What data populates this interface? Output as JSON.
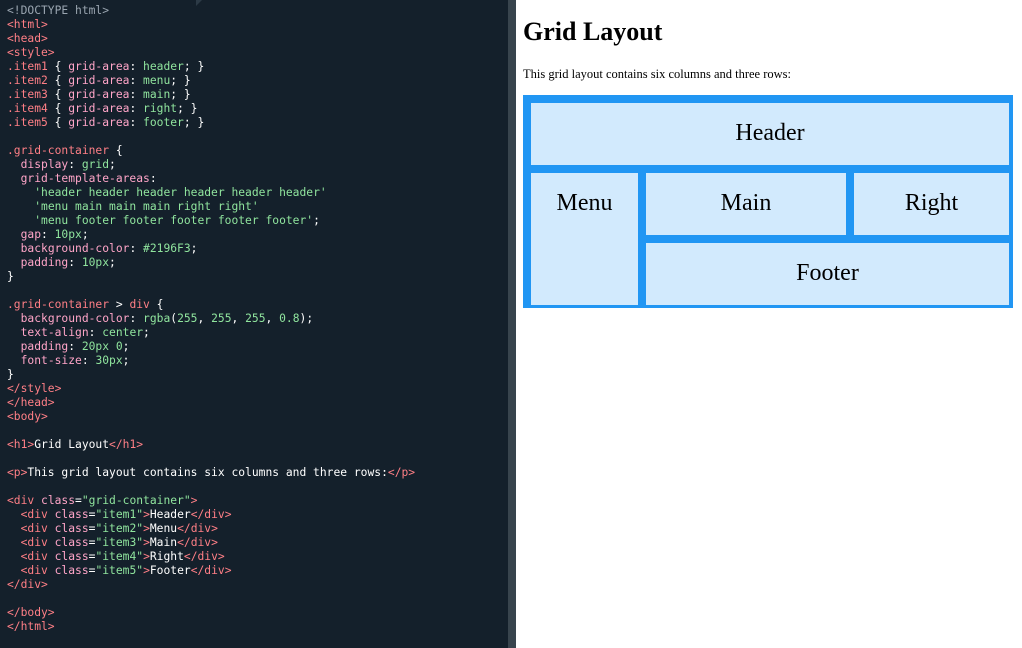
{
  "code_lines": [
    [
      [
        "tk-doctype",
        "<!DOCTYPE html>"
      ]
    ],
    [
      [
        "tk-tag",
        "<html>"
      ]
    ],
    [
      [
        "tk-tag",
        "<head>"
      ]
    ],
    [
      [
        "tk-tag",
        "<style>"
      ]
    ],
    [
      [
        "tk-sel",
        ".item1"
      ],
      [
        "tk-punct",
        " { "
      ],
      [
        "tk-prop",
        "grid-area"
      ],
      [
        "tk-punct",
        ": "
      ],
      [
        "tk-val",
        "header"
      ],
      [
        "tk-punct",
        "; }"
      ]
    ],
    [
      [
        "tk-sel",
        ".item2"
      ],
      [
        "tk-punct",
        " { "
      ],
      [
        "tk-prop",
        "grid-area"
      ],
      [
        "tk-punct",
        ": "
      ],
      [
        "tk-val",
        "menu"
      ],
      [
        "tk-punct",
        "; }"
      ]
    ],
    [
      [
        "tk-sel",
        ".item3"
      ],
      [
        "tk-punct",
        " { "
      ],
      [
        "tk-prop",
        "grid-area"
      ],
      [
        "tk-punct",
        ": "
      ],
      [
        "tk-val",
        "main"
      ],
      [
        "tk-punct",
        "; }"
      ]
    ],
    [
      [
        "tk-sel",
        ".item4"
      ],
      [
        "tk-punct",
        " { "
      ],
      [
        "tk-prop",
        "grid-area"
      ],
      [
        "tk-punct",
        ": "
      ],
      [
        "tk-val",
        "right"
      ],
      [
        "tk-punct",
        "; }"
      ]
    ],
    [
      [
        "tk-sel",
        ".item5"
      ],
      [
        "tk-punct",
        " { "
      ],
      [
        "tk-prop",
        "grid-area"
      ],
      [
        "tk-punct",
        ": "
      ],
      [
        "tk-val",
        "footer"
      ],
      [
        "tk-punct",
        "; }"
      ]
    ],
    [],
    [
      [
        "tk-sel",
        ".grid-container"
      ],
      [
        "tk-punct",
        " {"
      ]
    ],
    [
      [
        "tk-punct",
        "  "
      ],
      [
        "tk-prop",
        "display"
      ],
      [
        "tk-punct",
        ": "
      ],
      [
        "tk-val",
        "grid"
      ],
      [
        "tk-punct",
        ";"
      ]
    ],
    [
      [
        "tk-punct",
        "  "
      ],
      [
        "tk-prop",
        "grid-template-areas"
      ],
      [
        "tk-punct",
        ":"
      ]
    ],
    [
      [
        "tk-punct",
        "    "
      ],
      [
        "tk-val",
        "'header header header header header header'"
      ]
    ],
    [
      [
        "tk-punct",
        "    "
      ],
      [
        "tk-val",
        "'menu main main main right right'"
      ]
    ],
    [
      [
        "tk-punct",
        "    "
      ],
      [
        "tk-val",
        "'menu footer footer footer footer footer'"
      ],
      [
        "tk-punct",
        ";"
      ]
    ],
    [
      [
        "tk-punct",
        "  "
      ],
      [
        "tk-prop",
        "gap"
      ],
      [
        "tk-punct",
        ": "
      ],
      [
        "tk-val",
        "10px"
      ],
      [
        "tk-punct",
        ";"
      ]
    ],
    [
      [
        "tk-punct",
        "  "
      ],
      [
        "tk-prop",
        "background-color"
      ],
      [
        "tk-punct",
        ": "
      ],
      [
        "tk-val",
        "#2196F3"
      ],
      [
        "tk-punct",
        ";"
      ]
    ],
    [
      [
        "tk-punct",
        "  "
      ],
      [
        "tk-prop",
        "padding"
      ],
      [
        "tk-punct",
        ": "
      ],
      [
        "tk-val",
        "10px"
      ],
      [
        "tk-punct",
        ";"
      ]
    ],
    [
      [
        "tk-punct",
        "}"
      ]
    ],
    [],
    [
      [
        "tk-sel",
        ".grid-container"
      ],
      [
        "tk-punct",
        " > "
      ],
      [
        "tk-sel",
        "div"
      ],
      [
        "tk-punct",
        " {"
      ]
    ],
    [
      [
        "tk-punct",
        "  "
      ],
      [
        "tk-prop",
        "background-color"
      ],
      [
        "tk-punct",
        ": "
      ],
      [
        "tk-val",
        "rgba"
      ],
      [
        "tk-punct",
        "("
      ],
      [
        "tk-val",
        "255"
      ],
      [
        "tk-punct",
        ", "
      ],
      [
        "tk-val",
        "255"
      ],
      [
        "tk-punct",
        ", "
      ],
      [
        "tk-val",
        "255"
      ],
      [
        "tk-punct",
        ", "
      ],
      [
        "tk-val",
        "0.8"
      ],
      [
        "tk-punct",
        ");"
      ]
    ],
    [
      [
        "tk-punct",
        "  "
      ],
      [
        "tk-prop",
        "text-align"
      ],
      [
        "tk-punct",
        ": "
      ],
      [
        "tk-val",
        "center"
      ],
      [
        "tk-punct",
        ";"
      ]
    ],
    [
      [
        "tk-punct",
        "  "
      ],
      [
        "tk-prop",
        "padding"
      ],
      [
        "tk-punct",
        ": "
      ],
      [
        "tk-val",
        "20px 0"
      ],
      [
        "tk-punct",
        ";"
      ]
    ],
    [
      [
        "tk-punct",
        "  "
      ],
      [
        "tk-prop",
        "font-size"
      ],
      [
        "tk-punct",
        ": "
      ],
      [
        "tk-val",
        "30px"
      ],
      [
        "tk-punct",
        ";"
      ]
    ],
    [
      [
        "tk-punct",
        "}"
      ]
    ],
    [
      [
        "tk-tag",
        "</style>"
      ]
    ],
    [
      [
        "tk-tag",
        "</head>"
      ]
    ],
    [
      [
        "tk-tag",
        "<body>"
      ]
    ],
    [],
    [
      [
        "tk-tag",
        "<h1>"
      ],
      [
        "tk-text",
        "Grid Layout"
      ],
      [
        "tk-tag",
        "</h1>"
      ]
    ],
    [],
    [
      [
        "tk-tag",
        "<p>"
      ],
      [
        "tk-text",
        "This grid layout contains six columns and three rows:"
      ],
      [
        "tk-tag",
        "</p>"
      ]
    ],
    [],
    [
      [
        "tk-tag",
        "<div "
      ],
      [
        "tk-prop",
        "class"
      ],
      [
        "tk-punct",
        "="
      ],
      [
        "tk-val",
        "\"grid-container\""
      ],
      [
        "tk-tag",
        ">"
      ]
    ],
    [
      [
        "tk-punct",
        "  "
      ],
      [
        "tk-tag",
        "<div "
      ],
      [
        "tk-prop",
        "class"
      ],
      [
        "tk-punct",
        "="
      ],
      [
        "tk-val",
        "\"item1\""
      ],
      [
        "tk-tag",
        ">"
      ],
      [
        "tk-text",
        "Header"
      ],
      [
        "tk-tag",
        "</div>"
      ]
    ],
    [
      [
        "tk-punct",
        "  "
      ],
      [
        "tk-tag",
        "<div "
      ],
      [
        "tk-prop",
        "class"
      ],
      [
        "tk-punct",
        "="
      ],
      [
        "tk-val",
        "\"item2\""
      ],
      [
        "tk-tag",
        ">"
      ],
      [
        "tk-text",
        "Menu"
      ],
      [
        "tk-tag",
        "</div>"
      ]
    ],
    [
      [
        "tk-punct",
        "  "
      ],
      [
        "tk-tag",
        "<div "
      ],
      [
        "tk-prop",
        "class"
      ],
      [
        "tk-punct",
        "="
      ],
      [
        "tk-val",
        "\"item3\""
      ],
      [
        "tk-tag",
        ">"
      ],
      [
        "tk-text",
        "Main"
      ],
      [
        "tk-tag",
        "</div>"
      ]
    ],
    [
      [
        "tk-punct",
        "  "
      ],
      [
        "tk-tag",
        "<div "
      ],
      [
        "tk-prop",
        "class"
      ],
      [
        "tk-punct",
        "="
      ],
      [
        "tk-val",
        "\"item4\""
      ],
      [
        "tk-tag",
        ">"
      ],
      [
        "tk-text",
        "Right"
      ],
      [
        "tk-tag",
        "</div>"
      ]
    ],
    [
      [
        "tk-punct",
        "  "
      ],
      [
        "tk-tag",
        "<div "
      ],
      [
        "tk-prop",
        "class"
      ],
      [
        "tk-punct",
        "="
      ],
      [
        "tk-val",
        "\"item5\""
      ],
      [
        "tk-tag",
        ">"
      ],
      [
        "tk-text",
        "Footer"
      ],
      [
        "tk-tag",
        "</div>"
      ]
    ],
    [
      [
        "tk-tag",
        "</div>"
      ]
    ],
    [],
    [
      [
        "tk-tag",
        "</body>"
      ]
    ],
    [
      [
        "tk-tag",
        "</html>"
      ]
    ]
  ],
  "preview": {
    "heading": "Grid Layout",
    "paragraph": "This grid layout contains six columns and three rows:",
    "items": {
      "header": "Header",
      "menu": "Menu",
      "main": "Main",
      "right": "Right",
      "footer": "Footer"
    }
  },
  "colors": {
    "editor_background": "#14202b",
    "grid_background": "#2196f3",
    "cell_background": "rgba(255,255,255,0.8)"
  }
}
